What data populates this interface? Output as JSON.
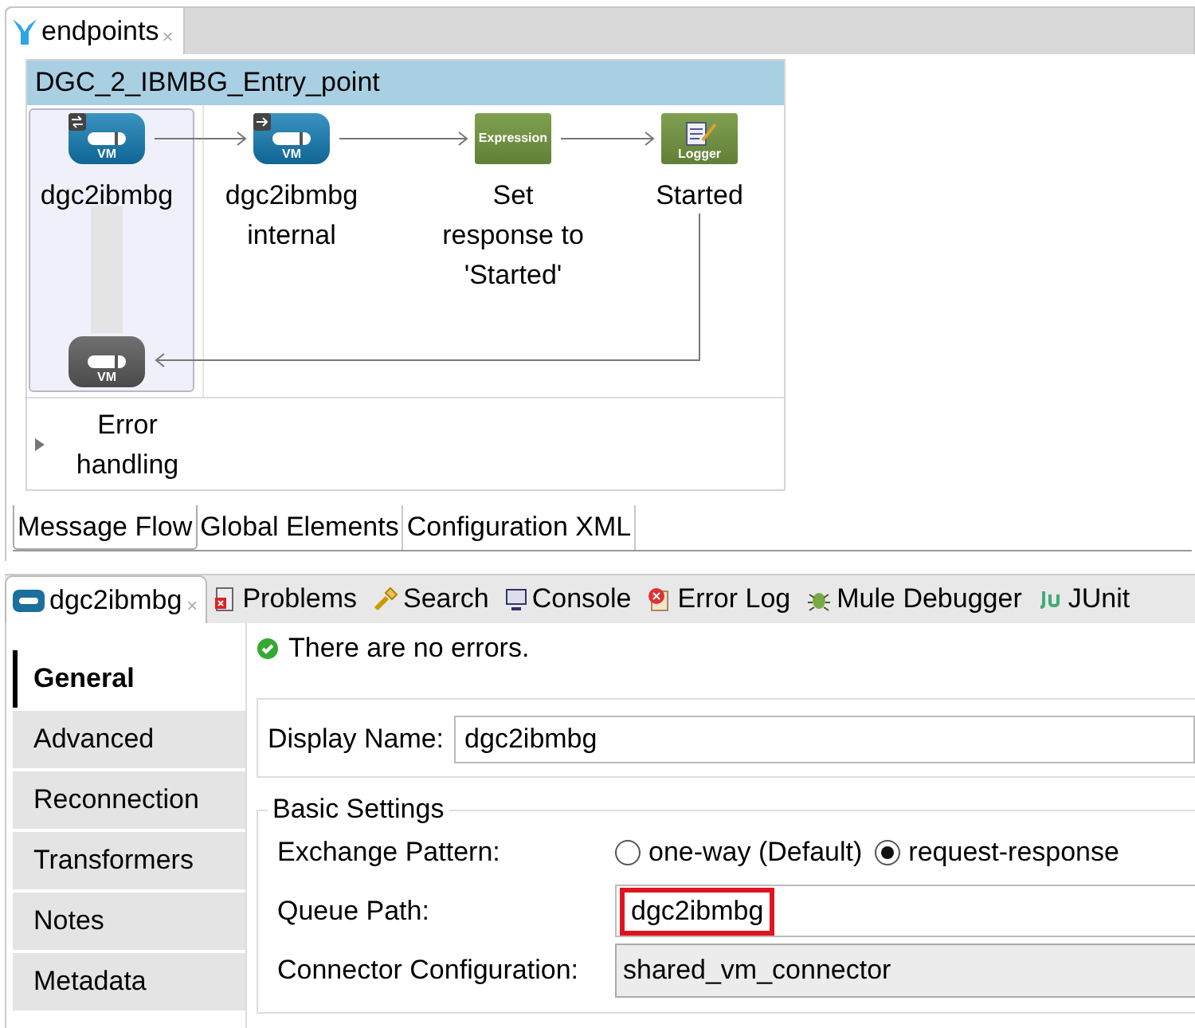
{
  "editor_tab": {
    "label": "endpoints",
    "close": "×"
  },
  "flow": {
    "name": "DGC_2_IBMBG_Entry_point",
    "nodes": [
      {
        "kind": "vm-two-way",
        "icon_label": "VM",
        "label": "dgc2ibmbg"
      },
      {
        "kind": "vm-one-way",
        "icon_label": "VM",
        "label": "dgc2ibmbg internal"
      },
      {
        "kind": "expression",
        "icon_label": "Expression",
        "label": "Set response to 'Started'"
      },
      {
        "kind": "logger",
        "icon_label": "Logger",
        "label": "Started"
      }
    ],
    "response_node": {
      "kind": "vm-response",
      "icon_label": "VM"
    },
    "error_handling": {
      "label": "Error handling",
      "expanded": false
    }
  },
  "editor_views": [
    {
      "label": "Message Flow",
      "selected": true
    },
    {
      "label": "Global Elements",
      "selected": false
    },
    {
      "label": "Configuration XML",
      "selected": false
    }
  ],
  "panel_tabs": [
    {
      "kind": "vm",
      "label": "dgc2ibmbg",
      "selected": true,
      "close": "×"
    },
    {
      "kind": "problems",
      "label": "Problems",
      "selected": false
    },
    {
      "kind": "search",
      "label": "Search",
      "selected": false
    },
    {
      "kind": "console",
      "label": "Console",
      "selected": false
    },
    {
      "kind": "errorlog",
      "label": "Error Log",
      "selected": false
    },
    {
      "kind": "debugger",
      "label": "Mule Debugger",
      "selected": false
    },
    {
      "kind": "junit",
      "label": "JUnit",
      "selected": false
    }
  ],
  "properties": {
    "status": "There are no errors.",
    "sections": [
      {
        "label": "General",
        "selected": true
      },
      {
        "label": "Advanced",
        "selected": false
      },
      {
        "label": "Reconnection",
        "selected": false
      },
      {
        "label": "Transformers",
        "selected": false
      },
      {
        "label": "Notes",
        "selected": false
      },
      {
        "label": "Metadata",
        "selected": false
      }
    ],
    "display_name": {
      "label": "Display Name:",
      "value": "dgc2ibmbg"
    },
    "basic_settings": {
      "title": "Basic Settings",
      "exchange_pattern": {
        "label": "Exchange Pattern:",
        "options": [
          {
            "label": "one-way (Default)",
            "selected": false
          },
          {
            "label": "request-response",
            "selected": true
          }
        ]
      },
      "queue_path": {
        "label": "Queue Path:",
        "value": "dgc2ibmbg",
        "highlighted": true
      },
      "connector_configuration": {
        "label": "Connector Configuration:",
        "value": "shared_vm_connector"
      }
    }
  }
}
